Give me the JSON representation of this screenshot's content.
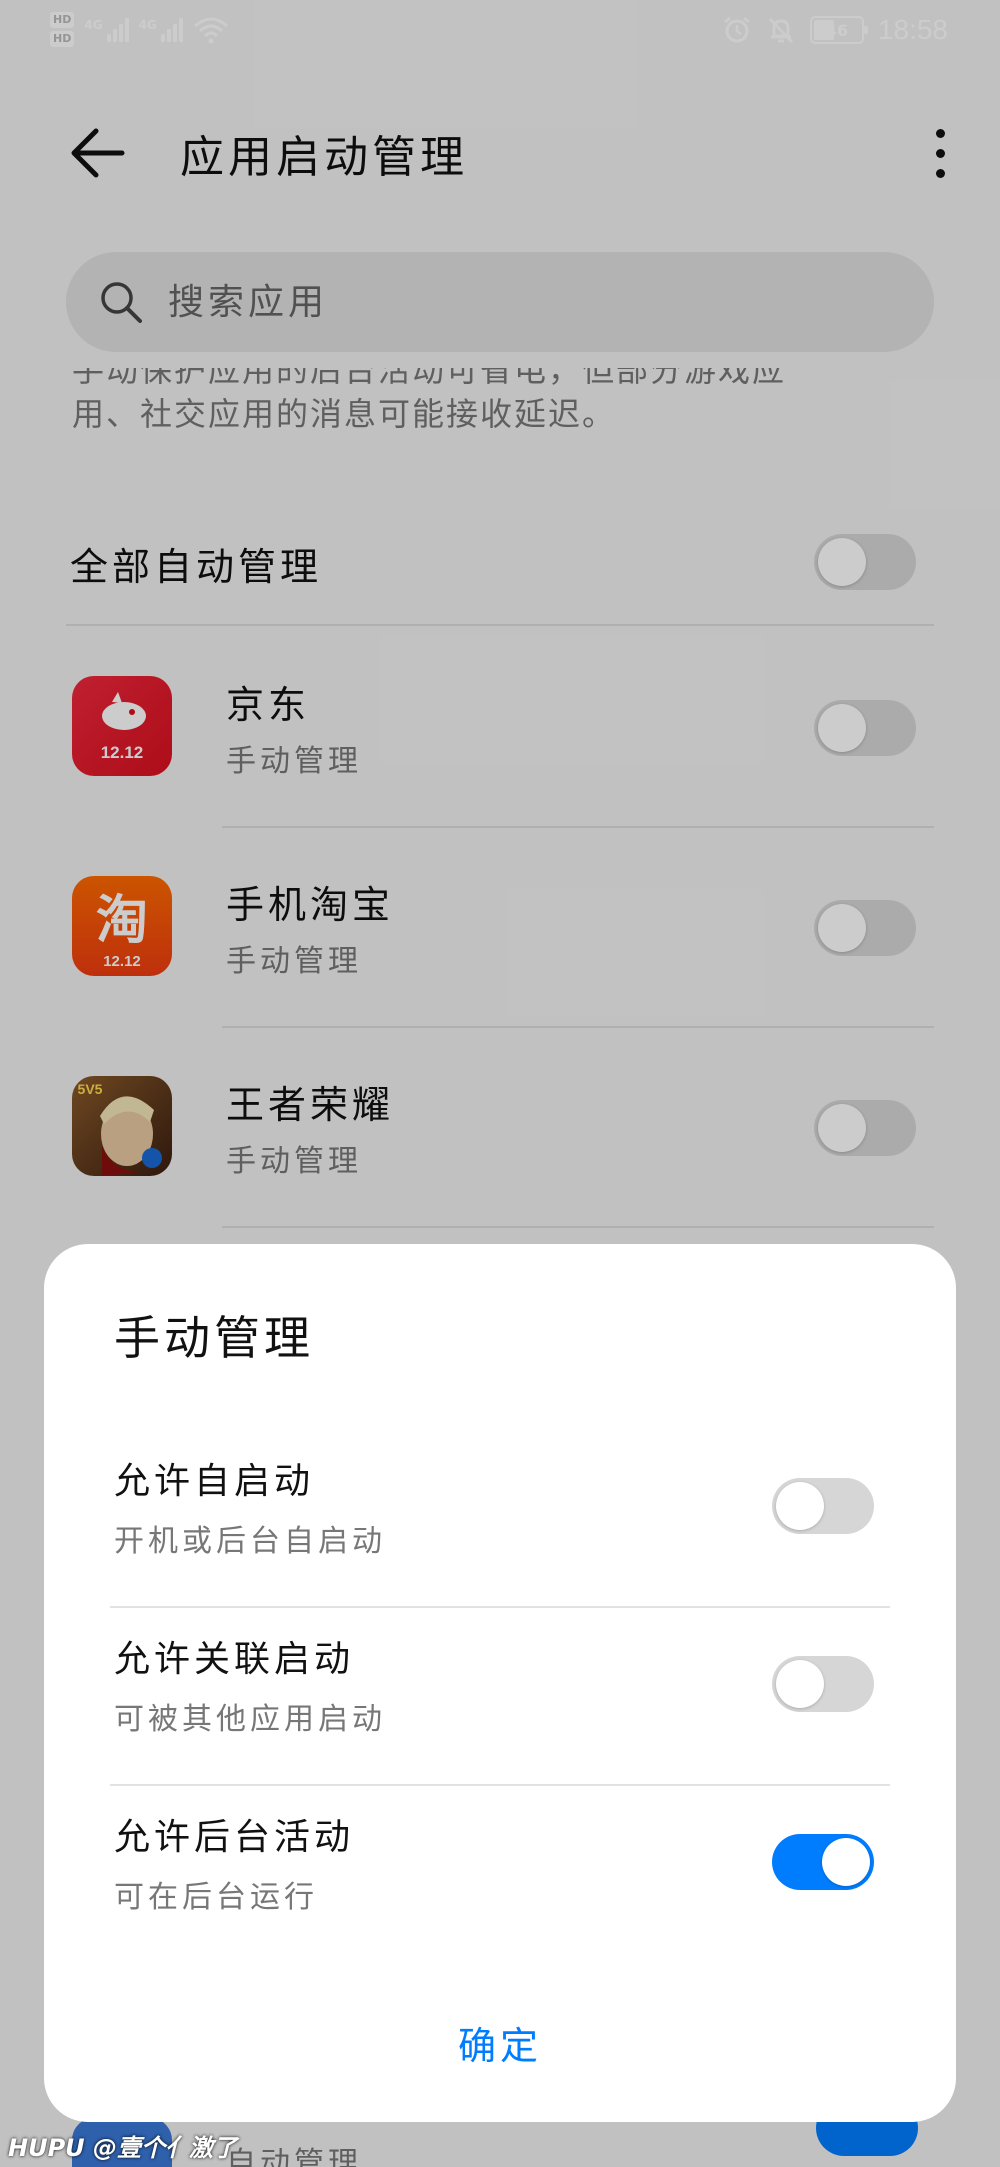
{
  "status_bar": {
    "hd_badges": [
      "HD",
      "HD"
    ],
    "network_1": "4G",
    "network_2": "4G",
    "battery": "46",
    "time": "18:58"
  },
  "header": {
    "title": "应用启动管理",
    "back_icon": "back-arrow-icon",
    "more_icon": "more-vertical-icon"
  },
  "search": {
    "placeholder": "搜索应用"
  },
  "description": {
    "partial_line": "手动保护应用的后台活动可省电，但部分游戏应",
    "line": "用、社交应用的消息可能接收延迟。"
  },
  "manage_all": {
    "label": "全部自动管理",
    "enabled": false
  },
  "apps": [
    {
      "name": "京东",
      "status": "手动管理",
      "icon_badge": "12.12",
      "enabled": false
    },
    {
      "name": "手机淘宝",
      "status": "手动管理",
      "icon_char": "淘",
      "icon_badge": "12.12",
      "enabled": false
    },
    {
      "name": "王者荣耀",
      "status": "手动管理",
      "icon_badge": "5V5",
      "enabled": false
    }
  ],
  "dialog": {
    "title": "手动管理",
    "options": [
      {
        "title": "允许自启动",
        "subtitle": "开机或后台自启动",
        "enabled": false
      },
      {
        "title": "允许关联启动",
        "subtitle": "可被其他应用启动",
        "enabled": false
      },
      {
        "title": "允许后台活动",
        "subtitle": "可在后台运行",
        "enabled": true
      }
    ],
    "confirm_label": "确定"
  },
  "partially_hidden_row": {
    "status": "自动管理",
    "enabled": true
  },
  "watermark": "HUPU @壹个亻激了",
  "colors": {
    "accent": "#007dff",
    "page_background": "#f2f2f2",
    "scrim": "rgba(0,0,0,0.2)"
  }
}
